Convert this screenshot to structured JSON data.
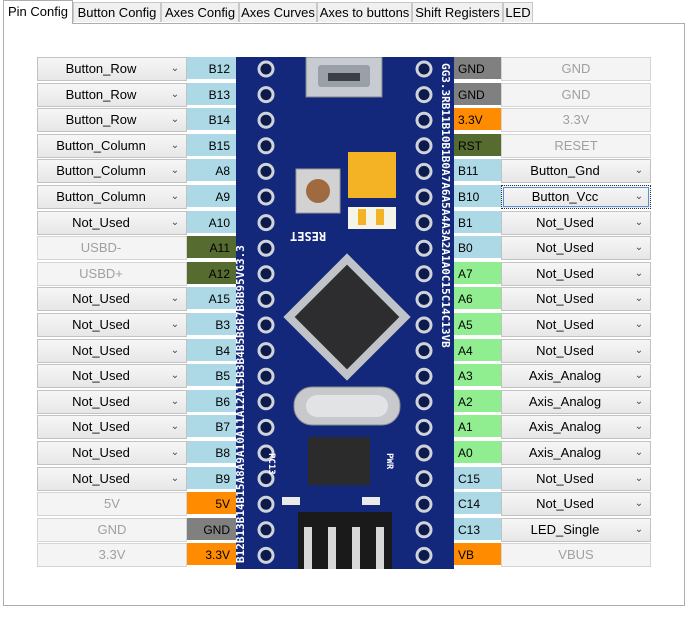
{
  "tabs": [
    "Pin Config",
    "Button Config",
    "Axes Config",
    "Axes Curves",
    "Axes to buttons",
    "Shift Registers",
    "LED"
  ],
  "active_tab": "Pin Config",
  "colors": {
    "pin_blue": "#add8e6",
    "pin_orange": "#ff8c00",
    "pin_gray": "#808080",
    "pin_darkgreen": "#556b2f",
    "pin_lightgreen": "#90ee90",
    "board": "#13287a"
  },
  "left_rows": [
    {
      "value": "Button_Row",
      "pin": "B12",
      "color": "#add8e6",
      "kind": "combo"
    },
    {
      "value": "Button_Row",
      "pin": "B13",
      "color": "#add8e6",
      "kind": "combo"
    },
    {
      "value": "Button_Row",
      "pin": "B14",
      "color": "#add8e6",
      "kind": "combo"
    },
    {
      "value": "Button_Column",
      "pin": "B15",
      "color": "#add8e6",
      "kind": "combo"
    },
    {
      "value": "Button_Column",
      "pin": "A8",
      "color": "#add8e6",
      "kind": "combo"
    },
    {
      "value": "Button_Column",
      "pin": "A9",
      "color": "#add8e6",
      "kind": "combo"
    },
    {
      "value": "Not_Used",
      "pin": "A10",
      "color": "#add8e6",
      "kind": "combo"
    },
    {
      "value": "USBD-",
      "pin": "A11",
      "color": "#556b2f",
      "kind": "disabled"
    },
    {
      "value": "USBD+",
      "pin": "A12",
      "color": "#556b2f",
      "kind": "disabled"
    },
    {
      "value": "Not_Used",
      "pin": "A15",
      "color": "#add8e6",
      "kind": "combo"
    },
    {
      "value": "Not_Used",
      "pin": "B3",
      "color": "#add8e6",
      "kind": "combo"
    },
    {
      "value": "Not_Used",
      "pin": "B4",
      "color": "#add8e6",
      "kind": "combo"
    },
    {
      "value": "Not_Used",
      "pin": "B5",
      "color": "#add8e6",
      "kind": "combo"
    },
    {
      "value": "Not_Used",
      "pin": "B6",
      "color": "#add8e6",
      "kind": "combo"
    },
    {
      "value": "Not_Used",
      "pin": "B7",
      "color": "#add8e6",
      "kind": "combo"
    },
    {
      "value": "Not_Used",
      "pin": "B8",
      "color": "#add8e6",
      "kind": "combo"
    },
    {
      "value": "Not_Used",
      "pin": "B9",
      "color": "#add8e6",
      "kind": "combo"
    },
    {
      "value": "5V",
      "pin": "5V",
      "color": "#ff8c00",
      "kind": "plain"
    },
    {
      "value": "GND",
      "pin": "GND",
      "color": "#808080",
      "kind": "plain"
    },
    {
      "value": "3.3V",
      "pin": "3.3V",
      "color": "#ff8c00",
      "kind": "plain"
    }
  ],
  "right_rows": [
    {
      "pin": "GND",
      "value": "GND",
      "color": "#808080",
      "kind": "plain"
    },
    {
      "pin": "GND",
      "value": "GND",
      "color": "#808080",
      "kind": "plain"
    },
    {
      "pin": "3.3V",
      "value": "3.3V",
      "color": "#ff8c00",
      "kind": "plain"
    },
    {
      "pin": "RST",
      "value": "RESET",
      "color": "#556b2f",
      "kind": "plain"
    },
    {
      "pin": "B11",
      "value": "Button_Gnd",
      "color": "#add8e6",
      "kind": "combo"
    },
    {
      "pin": "B10",
      "value": "Button_Vcc",
      "color": "#add8e6",
      "kind": "combo",
      "focus": true
    },
    {
      "pin": "B1",
      "value": "Not_Used",
      "color": "#add8e6",
      "kind": "combo"
    },
    {
      "pin": "B0",
      "value": "Not_Used",
      "color": "#add8e6",
      "kind": "combo"
    },
    {
      "pin": "A7",
      "value": "Not_Used",
      "color": "#90ee90",
      "kind": "combo"
    },
    {
      "pin": "A6",
      "value": "Not_Used",
      "color": "#90ee90",
      "kind": "combo"
    },
    {
      "pin": "A5",
      "value": "Not_Used",
      "color": "#90ee90",
      "kind": "combo"
    },
    {
      "pin": "A4",
      "value": "Not_Used",
      "color": "#90ee90",
      "kind": "combo"
    },
    {
      "pin": "A3",
      "value": "Axis_Analog",
      "color": "#90ee90",
      "kind": "combo"
    },
    {
      "pin": "A2",
      "value": "Axis_Analog",
      "color": "#90ee90",
      "kind": "combo"
    },
    {
      "pin": "A1",
      "value": "Axis_Analog",
      "color": "#90ee90",
      "kind": "combo"
    },
    {
      "pin": "A0",
      "value": "Axis_Analog",
      "color": "#90ee90",
      "kind": "combo"
    },
    {
      "pin": "C15",
      "value": "Not_Used",
      "color": "#add8e6",
      "kind": "combo"
    },
    {
      "pin": "C14",
      "value": "Not_Used",
      "color": "#add8e6",
      "kind": "combo"
    },
    {
      "pin": "C13",
      "value": "LED_Single",
      "color": "#add8e6",
      "kind": "combo"
    },
    {
      "pin": "VB",
      "value": "VBUS",
      "color": "#ff8c00",
      "kind": "plain"
    }
  ],
  "board": {
    "left_silk": "B12B13B14B15A8A9A10A11A12A15B3B4B5B6B7B8B95VG3.3",
    "right_silk": "GG3.3RB11B10B1B0A7A6A5A4A3A2A1A0C15C14C13VB",
    "reset_label": "RESET",
    "pc13_label": "PC13",
    "pwr_label": "PWR"
  }
}
